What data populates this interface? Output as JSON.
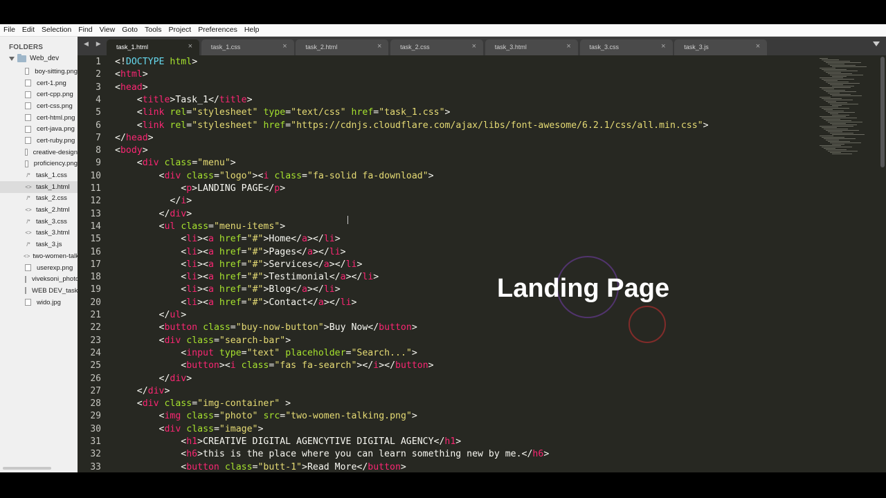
{
  "menu": [
    "File",
    "Edit",
    "Selection",
    "Find",
    "View",
    "Goto",
    "Tools",
    "Project",
    "Preferences",
    "Help"
  ],
  "sidebar": {
    "header": "FOLDERS",
    "root": "Web_dev",
    "files": [
      {
        "name": "boy-sitting.png",
        "type": "image"
      },
      {
        "name": "cert-1.png",
        "type": "image"
      },
      {
        "name": "cert-cpp.png",
        "type": "image"
      },
      {
        "name": "cert-css.png",
        "type": "image"
      },
      {
        "name": "cert-html.png",
        "type": "image"
      },
      {
        "name": "cert-java.png",
        "type": "image"
      },
      {
        "name": "cert-ruby.png",
        "type": "image"
      },
      {
        "name": "creative-design",
        "type": "image"
      },
      {
        "name": "proficiency.png",
        "type": "image"
      },
      {
        "name": "task_1.css",
        "type": "css"
      },
      {
        "name": "task_1.html",
        "type": "html",
        "active": true
      },
      {
        "name": "task_2.css",
        "type": "css"
      },
      {
        "name": "task_2.html",
        "type": "html"
      },
      {
        "name": "task_3.css",
        "type": "css"
      },
      {
        "name": "task_3.html",
        "type": "html"
      },
      {
        "name": "task_3.js",
        "type": "css"
      },
      {
        "name": "two-women-talking",
        "type": "html"
      },
      {
        "name": "userexp.png",
        "type": "image"
      },
      {
        "name": "viveksoni_photo",
        "type": "image"
      },
      {
        "name": "WEB DEV_task",
        "type": "image"
      },
      {
        "name": "wido.jpg",
        "type": "image"
      }
    ]
  },
  "tabs": [
    {
      "label": "task_1.html",
      "active": true
    },
    {
      "label": "task_1.css"
    },
    {
      "label": "task_2.html"
    },
    {
      "label": "task_2.css"
    },
    {
      "label": "task_3.html"
    },
    {
      "label": "task_3.css"
    },
    {
      "label": "task_3.js"
    }
  ],
  "tab_close": "×",
  "nav_arrows": "◀ ▶",
  "line_numbers": [
    "1",
    "2",
    "3",
    "4",
    "5",
    "6",
    "7",
    "8",
    "9",
    "10",
    "11",
    "12",
    "13",
    "14",
    "15",
    "16",
    "17",
    "18",
    "19",
    "20",
    "21",
    "22",
    "23",
    "24",
    "25",
    "26",
    "27",
    "28",
    "29",
    "30",
    "31",
    "32",
    "33"
  ],
  "code": [
    [
      [
        "p",
        "<!"
      ],
      [
        "d",
        "DOCTYPE"
      ],
      [
        "p",
        " "
      ],
      [
        "a",
        "html"
      ],
      [
        "p",
        ">"
      ]
    ],
    [
      [
        "p",
        "<"
      ],
      [
        "t",
        "html"
      ],
      [
        "p",
        ">"
      ]
    ],
    [
      [
        "p",
        "<"
      ],
      [
        "t",
        "head"
      ],
      [
        "p",
        ">"
      ]
    ],
    [
      [
        "p",
        "    <"
      ],
      [
        "t",
        "title"
      ],
      [
        "p",
        ">Task_1</"
      ],
      [
        "t",
        "title"
      ],
      [
        "p",
        ">"
      ]
    ],
    [
      [
        "p",
        "    <"
      ],
      [
        "t",
        "link"
      ],
      [
        "p",
        " "
      ],
      [
        "a",
        "rel"
      ],
      [
        "p",
        "="
      ],
      [
        "s",
        "\"stylesheet\""
      ],
      [
        "p",
        " "
      ],
      [
        "a",
        "type"
      ],
      [
        "p",
        "="
      ],
      [
        "s",
        "\"text/css\""
      ],
      [
        "p",
        " "
      ],
      [
        "a",
        "href"
      ],
      [
        "p",
        "="
      ],
      [
        "s",
        "\"task_1.css\""
      ],
      [
        "p",
        ">"
      ]
    ],
    [
      [
        "p",
        "    <"
      ],
      [
        "t",
        "link"
      ],
      [
        "p",
        " "
      ],
      [
        "a",
        "rel"
      ],
      [
        "p",
        "="
      ],
      [
        "s",
        "\"stylesheet\""
      ],
      [
        "p",
        " "
      ],
      [
        "a",
        "href"
      ],
      [
        "p",
        "="
      ],
      [
        "s",
        "\"https://cdnjs.cloudflare.com/ajax/libs/font-awesome/6.2.1/css/all.min.css\""
      ],
      [
        "p",
        ">"
      ]
    ],
    [
      [
        "p",
        "</"
      ],
      [
        "t",
        "head"
      ],
      [
        "p",
        ">"
      ]
    ],
    [
      [
        "p",
        "<"
      ],
      [
        "t",
        "body"
      ],
      [
        "p",
        ">"
      ]
    ],
    [
      [
        "p",
        "    <"
      ],
      [
        "t",
        "div"
      ],
      [
        "p",
        " "
      ],
      [
        "a",
        "class"
      ],
      [
        "p",
        "="
      ],
      [
        "s",
        "\"menu\""
      ],
      [
        "p",
        ">"
      ]
    ],
    [
      [
        "p",
        "        <"
      ],
      [
        "t",
        "div"
      ],
      [
        "p",
        " "
      ],
      [
        "a",
        "class"
      ],
      [
        "p",
        "="
      ],
      [
        "s",
        "\"logo\""
      ],
      [
        "p",
        "><"
      ],
      [
        "t",
        "i"
      ],
      [
        "p",
        " "
      ],
      [
        "a",
        "class"
      ],
      [
        "p",
        "="
      ],
      [
        "s",
        "\"fa-solid fa-download\""
      ],
      [
        "p",
        ">"
      ]
    ],
    [
      [
        "p",
        "            <"
      ],
      [
        "t",
        "p"
      ],
      [
        "p",
        ">LANDING PAGE</"
      ],
      [
        "t",
        "p"
      ],
      [
        "p",
        ">"
      ]
    ],
    [
      [
        "p",
        "          </"
      ],
      [
        "t",
        "i"
      ],
      [
        "p",
        ">"
      ]
    ],
    [
      [
        "p",
        "        </"
      ],
      [
        "t",
        "div"
      ],
      [
        "p",
        ">"
      ]
    ],
    [
      [
        "p",
        "        <"
      ],
      [
        "t",
        "ul"
      ],
      [
        "p",
        " "
      ],
      [
        "a",
        "class"
      ],
      [
        "p",
        "="
      ],
      [
        "s",
        "\"menu-items\""
      ],
      [
        "p",
        ">"
      ]
    ],
    [
      [
        "p",
        "            <"
      ],
      [
        "t",
        "li"
      ],
      [
        "p",
        "><"
      ],
      [
        "t",
        "a"
      ],
      [
        "p",
        " "
      ],
      [
        "a",
        "href"
      ],
      [
        "p",
        "="
      ],
      [
        "s",
        "\"#\""
      ],
      [
        "p",
        ">Home</"
      ],
      [
        "t",
        "a"
      ],
      [
        "p",
        "></"
      ],
      [
        "t",
        "li"
      ],
      [
        "p",
        ">"
      ]
    ],
    [
      [
        "p",
        "            <"
      ],
      [
        "t",
        "li"
      ],
      [
        "p",
        "><"
      ],
      [
        "t",
        "a"
      ],
      [
        "p",
        " "
      ],
      [
        "a",
        "href"
      ],
      [
        "p",
        "="
      ],
      [
        "s",
        "\"#\""
      ],
      [
        "p",
        ">Pages</"
      ],
      [
        "t",
        "a"
      ],
      [
        "p",
        "></"
      ],
      [
        "t",
        "li"
      ],
      [
        "p",
        ">"
      ]
    ],
    [
      [
        "p",
        "            <"
      ],
      [
        "t",
        "li"
      ],
      [
        "p",
        "><"
      ],
      [
        "t",
        "a"
      ],
      [
        "p",
        " "
      ],
      [
        "a",
        "href"
      ],
      [
        "p",
        "="
      ],
      [
        "s",
        "\"#\""
      ],
      [
        "p",
        ">Services</"
      ],
      [
        "t",
        "a"
      ],
      [
        "p",
        "></"
      ],
      [
        "t",
        "li"
      ],
      [
        "p",
        ">"
      ]
    ],
    [
      [
        "p",
        "            <"
      ],
      [
        "t",
        "li"
      ],
      [
        "p",
        "><"
      ],
      [
        "t",
        "a"
      ],
      [
        "p",
        " "
      ],
      [
        "a",
        "href"
      ],
      [
        "p",
        "="
      ],
      [
        "s",
        "\"#\""
      ],
      [
        "p",
        ">Testimonial</"
      ],
      [
        "t",
        "a"
      ],
      [
        "p",
        "></"
      ],
      [
        "t",
        "li"
      ],
      [
        "p",
        ">"
      ]
    ],
    [
      [
        "p",
        "            <"
      ],
      [
        "t",
        "li"
      ],
      [
        "p",
        "><"
      ],
      [
        "t",
        "a"
      ],
      [
        "p",
        " "
      ],
      [
        "a",
        "href"
      ],
      [
        "p",
        "="
      ],
      [
        "s",
        "\"#\""
      ],
      [
        "p",
        ">Blog</"
      ],
      [
        "t",
        "a"
      ],
      [
        "p",
        "></"
      ],
      [
        "t",
        "li"
      ],
      [
        "p",
        ">"
      ]
    ],
    [
      [
        "p",
        "            <"
      ],
      [
        "t",
        "li"
      ],
      [
        "p",
        "><"
      ],
      [
        "t",
        "a"
      ],
      [
        "p",
        " "
      ],
      [
        "a",
        "href"
      ],
      [
        "p",
        "="
      ],
      [
        "s",
        "\"#\""
      ],
      [
        "p",
        ">Contact</"
      ],
      [
        "t",
        "a"
      ],
      [
        "p",
        "></"
      ],
      [
        "t",
        "li"
      ],
      [
        "p",
        ">"
      ]
    ],
    [
      [
        "p",
        "        </"
      ],
      [
        "t",
        "ul"
      ],
      [
        "p",
        ">"
      ]
    ],
    [
      [
        "p",
        "        <"
      ],
      [
        "t",
        "button"
      ],
      [
        "p",
        " "
      ],
      [
        "a",
        "class"
      ],
      [
        "p",
        "="
      ],
      [
        "s",
        "\"buy-now-button\""
      ],
      [
        "p",
        ">Buy Now</"
      ],
      [
        "t",
        "button"
      ],
      [
        "p",
        ">"
      ]
    ],
    [
      [
        "p",
        "        <"
      ],
      [
        "t",
        "div"
      ],
      [
        "p",
        " "
      ],
      [
        "a",
        "class"
      ],
      [
        "p",
        "="
      ],
      [
        "s",
        "\"search-bar\""
      ],
      [
        "p",
        ">"
      ]
    ],
    [
      [
        "p",
        "            <"
      ],
      [
        "t",
        "input"
      ],
      [
        "p",
        " "
      ],
      [
        "a",
        "type"
      ],
      [
        "p",
        "="
      ],
      [
        "s",
        "\"text\""
      ],
      [
        "p",
        " "
      ],
      [
        "a",
        "placeholder"
      ],
      [
        "p",
        "="
      ],
      [
        "s",
        "\"Search...\""
      ],
      [
        "p",
        ">"
      ]
    ],
    [
      [
        "p",
        "            <"
      ],
      [
        "t",
        "button"
      ],
      [
        "p",
        "><"
      ],
      [
        "t",
        "i"
      ],
      [
        "p",
        " "
      ],
      [
        "a",
        "class"
      ],
      [
        "p",
        "="
      ],
      [
        "s",
        "\"fas fa-search\""
      ],
      [
        "p",
        "></"
      ],
      [
        "t",
        "i"
      ],
      [
        "p",
        "></"
      ],
      [
        "t",
        "button"
      ],
      [
        "p",
        ">"
      ]
    ],
    [
      [
        "p",
        "        </"
      ],
      [
        "t",
        "div"
      ],
      [
        "p",
        ">"
      ]
    ],
    [
      [
        "p",
        "    </"
      ],
      [
        "t",
        "div"
      ],
      [
        "p",
        ">"
      ]
    ],
    [
      [
        "p",
        "    <"
      ],
      [
        "t",
        "div"
      ],
      [
        "p",
        " "
      ],
      [
        "a",
        "class"
      ],
      [
        "p",
        "="
      ],
      [
        "s",
        "\"img-container\""
      ],
      [
        "p",
        " >"
      ]
    ],
    [
      [
        "p",
        "        <"
      ],
      [
        "t",
        "img"
      ],
      [
        "p",
        " "
      ],
      [
        "a",
        "class"
      ],
      [
        "p",
        "="
      ],
      [
        "s",
        "\"photo\""
      ],
      [
        "p",
        " "
      ],
      [
        "a",
        "src"
      ],
      [
        "p",
        "="
      ],
      [
        "s",
        "\"two-women-talking.png\""
      ],
      [
        "p",
        ">"
      ]
    ],
    [
      [
        "p",
        "        <"
      ],
      [
        "t",
        "div"
      ],
      [
        "p",
        " "
      ],
      [
        "a",
        "class"
      ],
      [
        "p",
        "="
      ],
      [
        "s",
        "\"image\""
      ],
      [
        "p",
        ">"
      ]
    ],
    [
      [
        "p",
        "            <"
      ],
      [
        "t",
        "h1"
      ],
      [
        "p",
        ">CREATIVE DIGITAL AGENCYTIVE DIGITAL AGENCY</"
      ],
      [
        "t",
        "h1"
      ],
      [
        "p",
        ">"
      ]
    ],
    [
      [
        "p",
        "            <"
      ],
      [
        "t",
        "h6"
      ],
      [
        "p",
        ">this is the place where you can learn something new by me.</"
      ],
      [
        "t",
        "h6"
      ],
      [
        "p",
        ">"
      ]
    ],
    [
      [
        "p",
        "            <"
      ],
      [
        "t",
        "button"
      ],
      [
        "p",
        " "
      ],
      [
        "a",
        "class"
      ],
      [
        "p",
        "="
      ],
      [
        "s",
        "\"butt-1\""
      ],
      [
        "p",
        ">Read More</"
      ],
      [
        "t",
        "button"
      ],
      [
        "p",
        ">"
      ]
    ]
  ],
  "overlay_title": "Landing Page",
  "colors": {
    "editor_bg": "#272822",
    "tag": "#f92672",
    "attribute": "#a6e22e",
    "string": "#e6db74",
    "doctype": "#66d9ef",
    "plain": "#f8f8f2"
  }
}
